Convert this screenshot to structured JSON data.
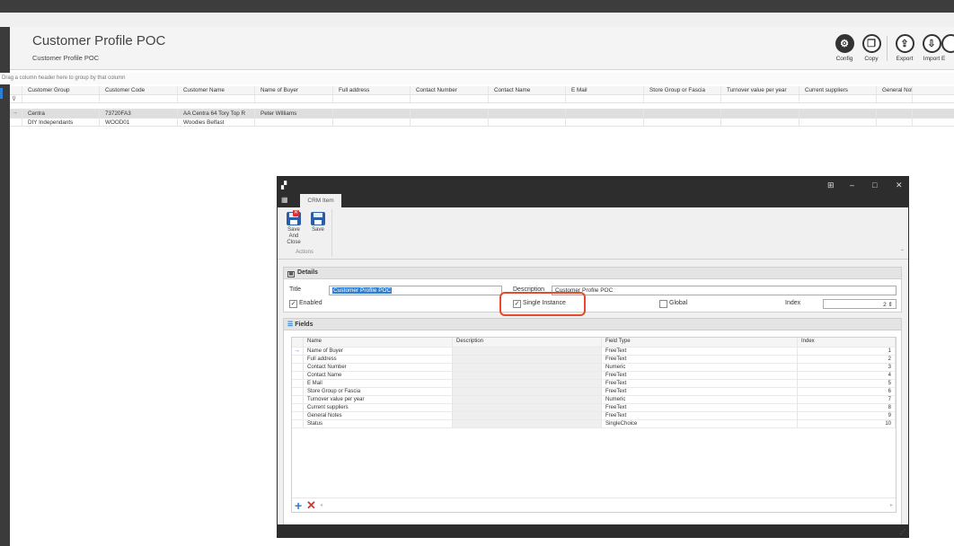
{
  "header": {
    "title": "Customer Profile POC",
    "subtitle": "Customer Profile POC",
    "toolbar": [
      {
        "label": "Config",
        "icon": "gear-icon"
      },
      {
        "label": "Copy",
        "icon": "copy-icon"
      },
      {
        "label": "Export",
        "icon": "export-icon"
      },
      {
        "label": "Import",
        "icon": "import-icon"
      },
      {
        "label": "E",
        "icon": "truncated-icon"
      }
    ]
  },
  "grid": {
    "group_hint": "Drag a column header here to group by that column",
    "columns": [
      "Customer Group",
      "Customer Code",
      "Customer Name",
      "Name of Buyer",
      "Full address",
      "Contact Number",
      "Contact Name",
      "E Mail",
      "Store Group or Fascia",
      "Turnover value per year",
      "Current suppliers",
      "General Notes"
    ],
    "rows": [
      [
        "Centra",
        "73720FA3",
        "AA Centra 64 Tory Top R",
        "Peter Williams",
        "",
        "",
        "",
        "",
        "",
        "",
        "",
        ""
      ],
      [
        "DIY Independants",
        "WOOD01",
        "Woodies Belfast",
        "",
        "",
        "",
        "",
        "",
        "",
        "",
        "",
        ""
      ]
    ]
  },
  "dialog": {
    "tab": "CRM Item",
    "ribbon": {
      "save_close": "Save And Close",
      "save": "Save",
      "group": "Actions"
    },
    "details": {
      "heading": "Details",
      "title_label": "Title",
      "title_value": "Customer Profile POC",
      "description_label": "Description",
      "description_value": "Customer Profile POC",
      "enabled_label": "Enabled",
      "enabled": true,
      "single_instance_label": "Single Instance",
      "single_instance": true,
      "global_label": "Global",
      "global": false,
      "index_label": "Index",
      "index_value": "2"
    },
    "fields": {
      "heading": "Fields",
      "columns": [
        "Name",
        "Description",
        "Field Type",
        "Index"
      ],
      "rows": [
        [
          "Name of Buyer",
          "",
          "FreeText",
          "1"
        ],
        [
          "Full address",
          "",
          "FreeText",
          "2"
        ],
        [
          "Contact Number",
          "",
          "Numeric",
          "3"
        ],
        [
          "Contact Name",
          "",
          "FreeText",
          "4"
        ],
        [
          "E Mail",
          "",
          "FreeText",
          "5"
        ],
        [
          "Store Group or Fascia",
          "",
          "FreeText",
          "6"
        ],
        [
          "Turnover value per year",
          "",
          "Numeric",
          "7"
        ],
        [
          "Current suppliers",
          "",
          "FreeText",
          "8"
        ],
        [
          "General Notes",
          "",
          "FreeText",
          "9"
        ],
        [
          "Status",
          "",
          "SingleChoice",
          "10"
        ]
      ]
    }
  }
}
